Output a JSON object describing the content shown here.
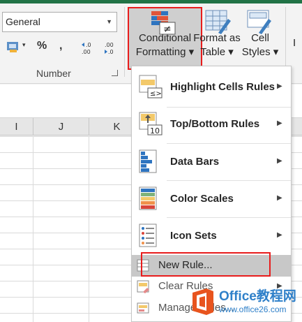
{
  "ribbon": {
    "number_format": {
      "value": "General"
    },
    "number_group_label": "Number",
    "buttons": {
      "currency": "$",
      "percent": "%",
      "comma": ",",
      "increase_decimal": ".0 .00",
      "decrease_decimal": ".00 .0"
    },
    "conditional_formatting": {
      "line1": "Conditional",
      "line2": "Formatting ▾"
    },
    "format_as_table": {
      "line1": "Format as",
      "line2": "Table ▾"
    },
    "cell_styles": {
      "line1": "Cell",
      "line2": "Styles ▾"
    },
    "insert_partial": "I"
  },
  "columns": [
    "I",
    "J",
    "K"
  ],
  "menu": {
    "items": [
      {
        "label": "Highlight Cells Rules",
        "icon": "highlight-cells-icon"
      },
      {
        "label": "Top/Bottom Rules",
        "icon": "top-bottom-icon"
      },
      {
        "label": "Data Bars",
        "icon": "data-bars-icon"
      },
      {
        "label": "Color Scales",
        "icon": "color-scales-icon"
      },
      {
        "label": "Icon Sets",
        "icon": "icon-sets-icon"
      }
    ],
    "small_items": [
      {
        "label": "New Rule...",
        "icon": "new-rule-icon"
      },
      {
        "label": "Clear Rules",
        "icon": "clear-rules-icon"
      },
      {
        "label": "Manage Rules...",
        "icon": "manage-rules-icon"
      }
    ]
  },
  "watermark": {
    "title": "Office教程网",
    "url": "www.office26.com"
  },
  "colors": {
    "accent_green": "#217346",
    "highlight_red": "#e81c1c",
    "watermark_blue": "#2f80c9"
  }
}
